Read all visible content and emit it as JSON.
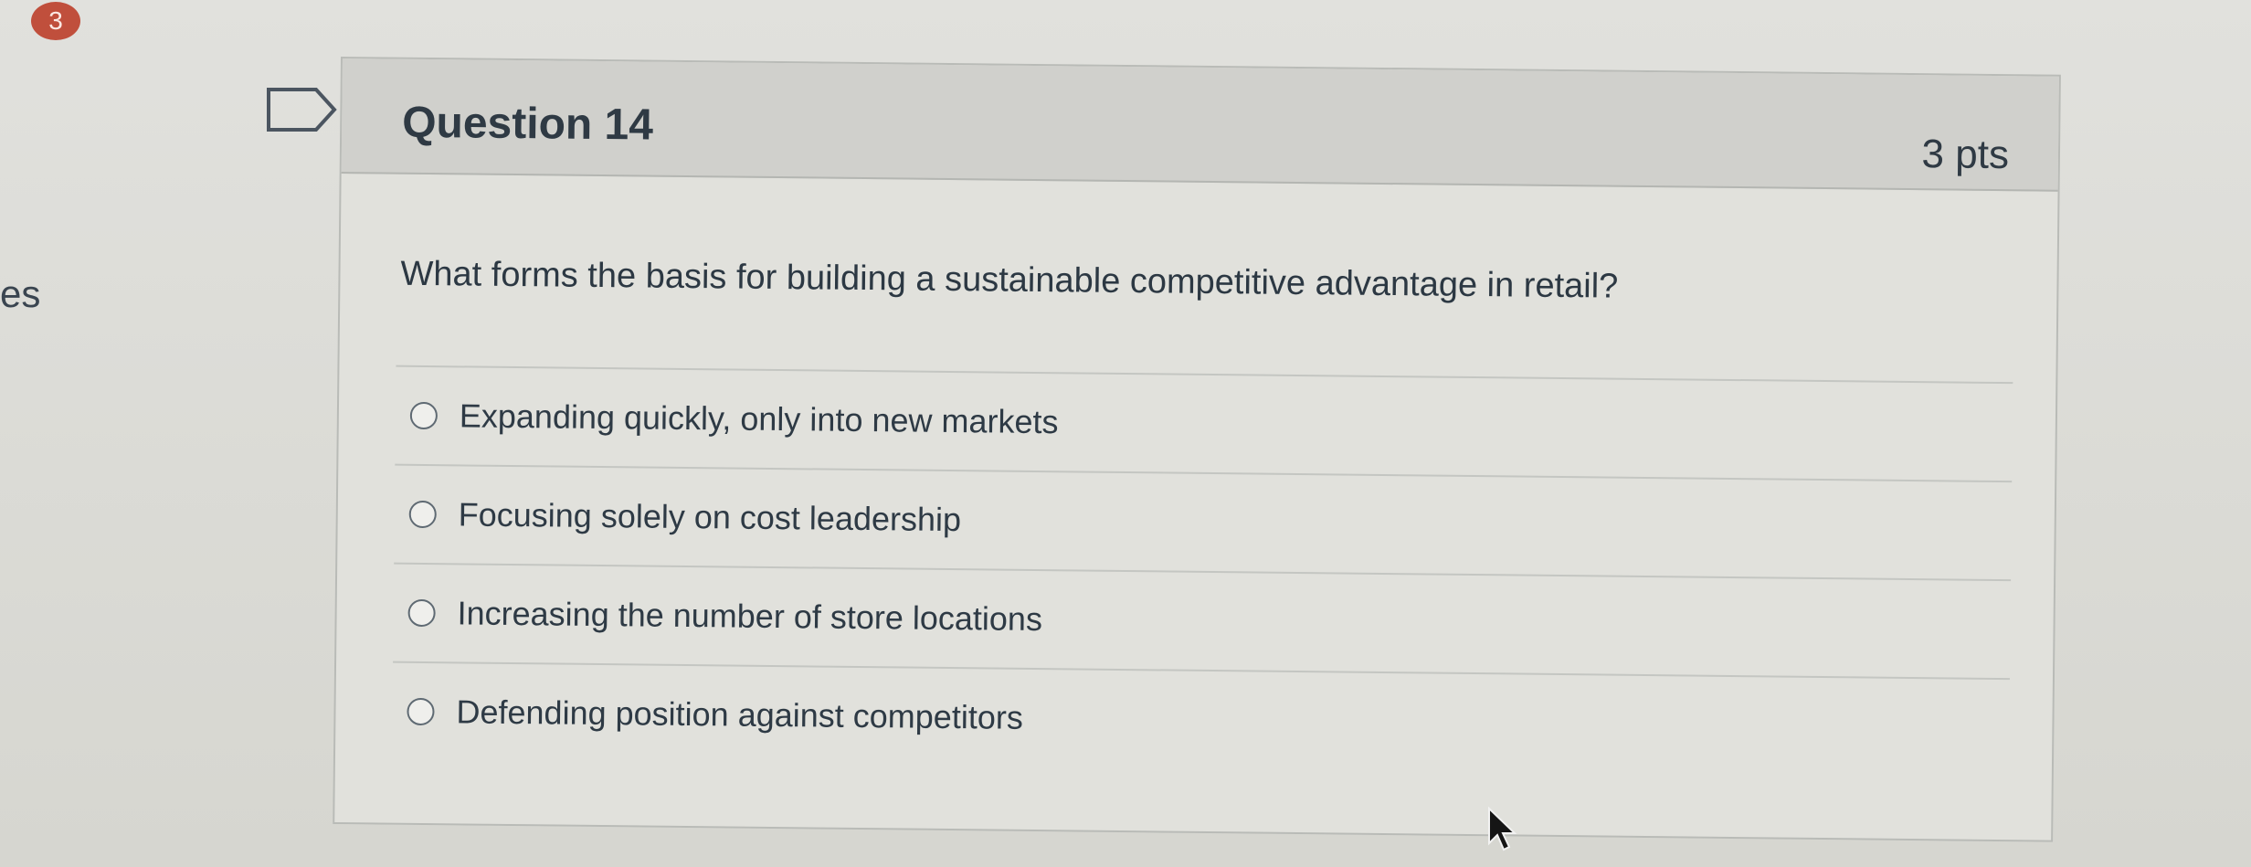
{
  "sidebar": {
    "badge_count": "3",
    "partial_label": "es"
  },
  "question": {
    "title": "Question 14",
    "points": "3 pts",
    "text": "What forms the basis for building a sustainable competitive advantage in retail?",
    "answers": [
      {
        "label": "Expanding quickly, only into new markets"
      },
      {
        "label": "Focusing solely on cost leadership"
      },
      {
        "label": "Increasing the number of store locations"
      },
      {
        "label": "Defending position against competitors"
      }
    ]
  },
  "icons": {
    "flag": "flag-question-icon",
    "cursor": "mouse-pointer-icon",
    "radio": "radio-button-icon"
  },
  "colors": {
    "badge": "#c04f3c",
    "header_bg": "#d0d0cc",
    "text": "#2f3a44"
  }
}
